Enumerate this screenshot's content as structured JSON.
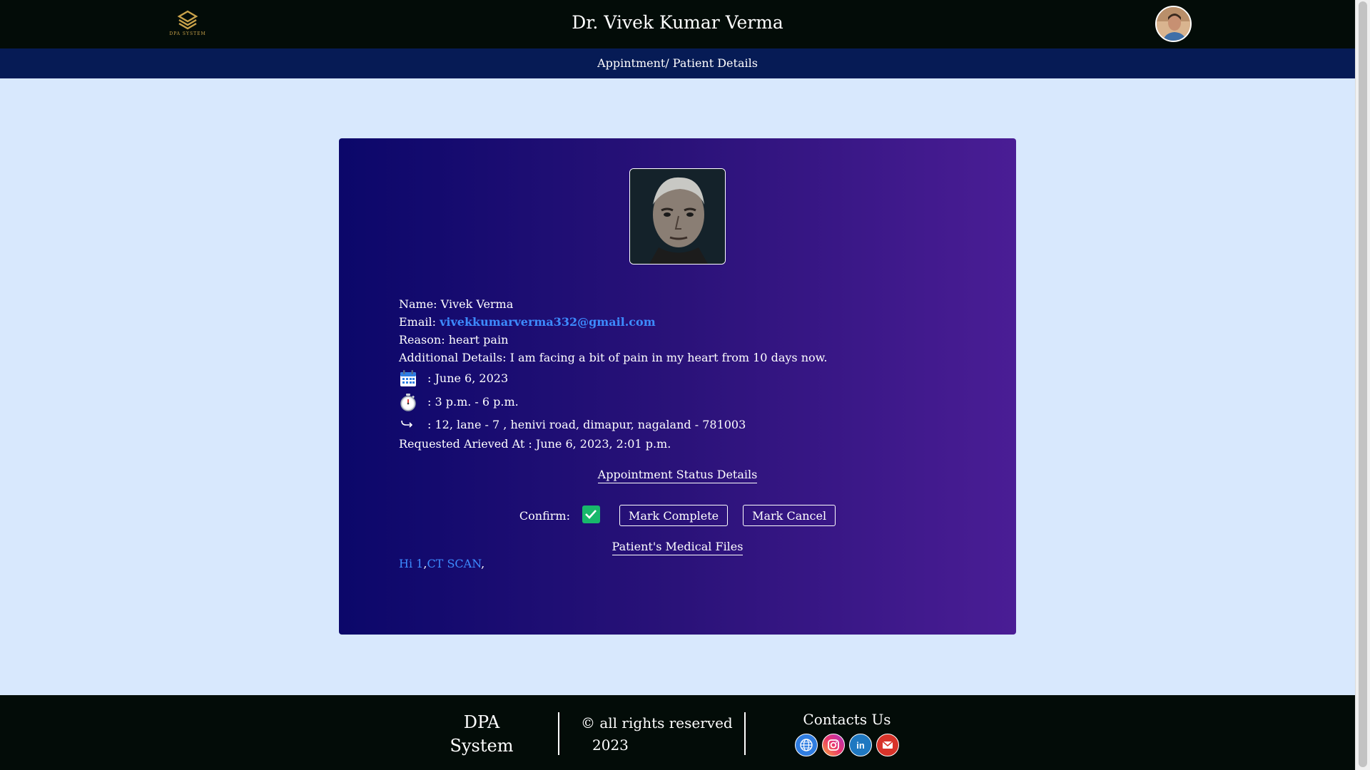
{
  "header": {
    "logo_text": "DPA SYSTEM",
    "doctor_name": "Dr. Vivek Kumar Verma"
  },
  "subheader": {
    "title": "Appintment/ Patient Details"
  },
  "patient": {
    "name_label": "Name:",
    "name": "Vivek Verma",
    "email_label": "Email:",
    "email": "vivekkumarverma332@gmail.com",
    "reason_label": "Reason:",
    "reason": "heart pain",
    "details_label": "Additional Details:",
    "details": "I am facing a bit of pain in my heart from 10 days now.",
    "date": ": June 6, 2023",
    "time": ": 3 p.m. - 6 p.m.",
    "address": ": 12, lane - 7 , henivi road, dimapur, nagaland - 781003",
    "requested": "Requested Arieved At : June 6, 2023, 2:01 p.m."
  },
  "status": {
    "title": "Appointment Status Details",
    "confirm_label": "Confirm:",
    "confirmed": true,
    "mark_complete": "Mark Complete",
    "mark_cancel": "Mark Cancel"
  },
  "files": {
    "title": "Patient's Medical Files",
    "items": [
      "Hi 1",
      "CT SCAN"
    ],
    "separator": ","
  },
  "footer": {
    "brand_line1": "DPA",
    "brand_line2": "System",
    "copyright": "© all rights reserved",
    "year": "2023",
    "contacts_title": "Contacts Us"
  },
  "colors": {
    "header_bg": "#030c08",
    "subheader_bg": "#061b55",
    "page_bg": "#d8e8fd",
    "card_gradient_start": "#0b076a",
    "card_gradient_end": "#4a1d95",
    "link": "#3d8bff",
    "check": "#18b86b"
  },
  "icons": [
    "calendar-icon",
    "stopwatch-icon",
    "return-arrow-icon",
    "globe-icon",
    "instagram-icon",
    "linkedin-icon",
    "gmail-icon"
  ]
}
